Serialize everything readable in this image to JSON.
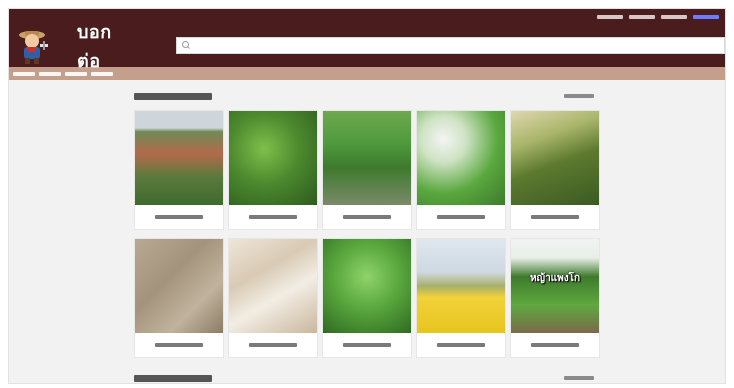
{
  "topbar": {
    "left_text": "",
    "links": [
      {
        "label": ""
      },
      {
        "label": ""
      },
      {
        "label": ""
      },
      {
        "label": ""
      }
    ]
  },
  "header": {
    "logo_text": "บอกต่อ",
    "search_placeholder": "",
    "mascot_icon": "farmer-mascot-icon",
    "search_icon": "search-icon"
  },
  "nav": {
    "items": [
      {
        "label": ""
      },
      {
        "label": ""
      },
      {
        "label": ""
      },
      {
        "label": ""
      }
    ]
  },
  "section1": {
    "title": "",
    "more_label": "",
    "cards": [
      {
        "title": "",
        "caption": ""
      },
      {
        "title": "",
        "caption": ""
      },
      {
        "title": "",
        "caption": ""
      },
      {
        "title": "",
        "caption": ""
      },
      {
        "title": "",
        "caption": ""
      },
      {
        "title": "",
        "caption": ""
      },
      {
        "title": "",
        "caption": ""
      },
      {
        "title": "",
        "caption": ""
      },
      {
        "title": "",
        "caption": ""
      },
      {
        "title": "",
        "caption": "หญ้าแพงโก"
      }
    ]
  },
  "section2": {
    "title": "",
    "more_label": ""
  },
  "colors": {
    "header_bg": "#4a1c1d",
    "nav_bg": "#c39f8c",
    "page_bg": "#f2f2f2"
  }
}
